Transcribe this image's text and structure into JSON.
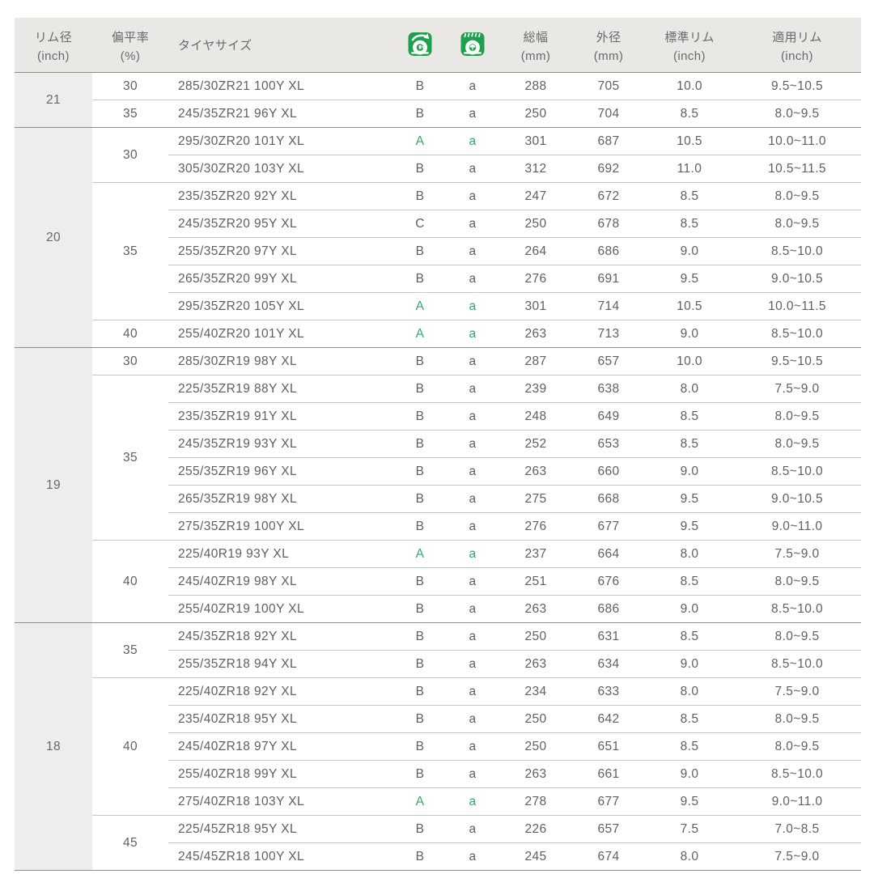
{
  "colors": {
    "icon_green": "#1ea050",
    "grade_green": "#39a566",
    "header_bg": "#eae8e5",
    "rim_column_bg": "#efedeb",
    "section_line": "#8f8d8a",
    "row_line": "#c8c6c3",
    "text": "#5f5f5f"
  },
  "table": {
    "columns": [
      {
        "key": "rim",
        "label": "リム径",
        "sub": "(inch)",
        "icon": null
      },
      {
        "key": "aspect",
        "label": "偏平率",
        "sub": "(%)",
        "icon": null
      },
      {
        "key": "size",
        "label": "タイヤサイズ",
        "sub": "",
        "icon": null
      },
      {
        "key": "fuel",
        "label": "",
        "sub": "",
        "icon": "fuel-efficiency-icon"
      },
      {
        "key": "wet",
        "label": "",
        "sub": "",
        "icon": "wet-grip-icon"
      },
      {
        "key": "width",
        "label": "総幅",
        "sub": "(mm)",
        "icon": null
      },
      {
        "key": "outer",
        "label": "外径",
        "sub": "(mm)",
        "icon": null
      },
      {
        "key": "std",
        "label": "標準リム",
        "sub": "(inch)",
        "icon": null
      },
      {
        "key": "range",
        "label": "適用リム",
        "sub": "(inch)",
        "icon": null
      }
    ],
    "sections": [
      {
        "rim": "21",
        "groups": [
          {
            "aspect": "30",
            "rows": [
              {
                "size": "285/30ZR21 100Y XL",
                "fuel": "B",
                "wet": "a",
                "width": "288",
                "outer": "705",
                "std": "10.0",
                "range": "9.5~10.5",
                "hl": false
              }
            ]
          },
          {
            "aspect": "35",
            "rows": [
              {
                "size": "245/35ZR21 96Y XL",
                "fuel": "B",
                "wet": "a",
                "width": "250",
                "outer": "704",
                "std": "8.5",
                "range": "8.0~9.5",
                "hl": false
              }
            ]
          }
        ]
      },
      {
        "rim": "20",
        "groups": [
          {
            "aspect": "30",
            "rows": [
              {
                "size": "295/30ZR20 101Y XL",
                "fuel": "A",
                "wet": "a",
                "width": "301",
                "outer": "687",
                "std": "10.5",
                "range": "10.0~11.0",
                "hl": true
              },
              {
                "size": "305/30ZR20 103Y XL",
                "fuel": "B",
                "wet": "a",
                "width": "312",
                "outer": "692",
                "std": "11.0",
                "range": "10.5~11.5",
                "hl": false
              }
            ]
          },
          {
            "aspect": "35",
            "rows": [
              {
                "size": "235/35ZR20 92Y XL",
                "fuel": "B",
                "wet": "a",
                "width": "247",
                "outer": "672",
                "std": "8.5",
                "range": "8.0~9.5",
                "hl": false
              },
              {
                "size": "245/35ZR20 95Y XL",
                "fuel": "C",
                "wet": "a",
                "width": "250",
                "outer": "678",
                "std": "8.5",
                "range": "8.0~9.5",
                "hl": false
              },
              {
                "size": "255/35ZR20 97Y XL",
                "fuel": "B",
                "wet": "a",
                "width": "264",
                "outer": "686",
                "std": "9.0",
                "range": "8.5~10.0",
                "hl": false
              },
              {
                "size": "265/35ZR20 99Y XL",
                "fuel": "B",
                "wet": "a",
                "width": "276",
                "outer": "691",
                "std": "9.5",
                "range": "9.0~10.5",
                "hl": false
              },
              {
                "size": "295/35ZR20 105Y XL",
                "fuel": "A",
                "wet": "a",
                "width": "301",
                "outer": "714",
                "std": "10.5",
                "range": "10.0~11.5",
                "hl": true
              }
            ]
          },
          {
            "aspect": "40",
            "rows": [
              {
                "size": "255/40ZR20 101Y XL",
                "fuel": "A",
                "wet": "a",
                "width": "263",
                "outer": "713",
                "std": "9.0",
                "range": "8.5~10.0",
                "hl": true
              }
            ]
          }
        ]
      },
      {
        "rim": "19",
        "groups": [
          {
            "aspect": "30",
            "rows": [
              {
                "size": "285/30ZR19 98Y XL",
                "fuel": "B",
                "wet": "a",
                "width": "287",
                "outer": "657",
                "std": "10.0",
                "range": "9.5~10.5",
                "hl": false
              }
            ]
          },
          {
            "aspect": "35",
            "rows": [
              {
                "size": "225/35ZR19 88Y XL",
                "fuel": "B",
                "wet": "a",
                "width": "239",
                "outer": "638",
                "std": "8.0",
                "range": "7.5~9.0",
                "hl": false
              },
              {
                "size": "235/35ZR19 91Y XL",
                "fuel": "B",
                "wet": "a",
                "width": "248",
                "outer": "649",
                "std": "8.5",
                "range": "8.0~9.5",
                "hl": false
              },
              {
                "size": "245/35ZR19 93Y XL",
                "fuel": "B",
                "wet": "a",
                "width": "252",
                "outer": "653",
                "std": "8.5",
                "range": "8.0~9.5",
                "hl": false
              },
              {
                "size": "255/35ZR19 96Y XL",
                "fuel": "B",
                "wet": "a",
                "width": "263",
                "outer": "660",
                "std": "9.0",
                "range": "8.5~10.0",
                "hl": false
              },
              {
                "size": "265/35ZR19 98Y XL",
                "fuel": "B",
                "wet": "a",
                "width": "275",
                "outer": "668",
                "std": "9.5",
                "range": "9.0~10.5",
                "hl": false
              },
              {
                "size": "275/35ZR19 100Y XL",
                "fuel": "B",
                "wet": "a",
                "width": "276",
                "outer": "677",
                "std": "9.5",
                "range": "9.0~11.0",
                "hl": false
              }
            ]
          },
          {
            "aspect": "40",
            "rows": [
              {
                "size": "225/40R19 93Y XL",
                "fuel": "A",
                "wet": "a",
                "width": "237",
                "outer": "664",
                "std": "8.0",
                "range": "7.5~9.0",
                "hl": true
              },
              {
                "size": "245/40ZR19 98Y XL",
                "fuel": "B",
                "wet": "a",
                "width": "251",
                "outer": "676",
                "std": "8.5",
                "range": "8.0~9.5",
                "hl": false
              },
              {
                "size": "255/40ZR19 100Y XL",
                "fuel": "B",
                "wet": "a",
                "width": "263",
                "outer": "686",
                "std": "9.0",
                "range": "8.5~10.0",
                "hl": false
              }
            ]
          }
        ]
      },
      {
        "rim": "18",
        "groups": [
          {
            "aspect": "35",
            "rows": [
              {
                "size": "245/35ZR18 92Y XL",
                "fuel": "B",
                "wet": "a",
                "width": "250",
                "outer": "631",
                "std": "8.5",
                "range": "8.0~9.5",
                "hl": false
              },
              {
                "size": "255/35ZR18 94Y XL",
                "fuel": "B",
                "wet": "a",
                "width": "263",
                "outer": "634",
                "std": "9.0",
                "range": "8.5~10.0",
                "hl": false
              }
            ]
          },
          {
            "aspect": "40",
            "rows": [
              {
                "size": "225/40ZR18 92Y XL",
                "fuel": "B",
                "wet": "a",
                "width": "234",
                "outer": "633",
                "std": "8.0",
                "range": "7.5~9.0",
                "hl": false
              },
              {
                "size": "235/40ZR18 95Y XL",
                "fuel": "B",
                "wet": "a",
                "width": "250",
                "outer": "642",
                "std": "8.5",
                "range": "8.0~9.5",
                "hl": false
              },
              {
                "size": "245/40ZR18 97Y XL",
                "fuel": "B",
                "wet": "a",
                "width": "250",
                "outer": "651",
                "std": "8.5",
                "range": "8.0~9.5",
                "hl": false
              },
              {
                "size": "255/40ZR18 99Y XL",
                "fuel": "B",
                "wet": "a",
                "width": "263",
                "outer": "661",
                "std": "9.0",
                "range": "8.5~10.0",
                "hl": false
              },
              {
                "size": "275/40ZR18 103Y XL",
                "fuel": "A",
                "wet": "a",
                "width": "278",
                "outer": "677",
                "std": "9.5",
                "range": "9.0~11.0",
                "hl": true
              }
            ]
          },
          {
            "aspect": "45",
            "rows": [
              {
                "size": "225/45ZR18 95Y XL",
                "fuel": "B",
                "wet": "a",
                "width": "226",
                "outer": "657",
                "std": "7.5",
                "range": "7.0~8.5",
                "hl": false
              },
              {
                "size": "245/45ZR18 100Y XL",
                "fuel": "B",
                "wet": "a",
                "width": "245",
                "outer": "674",
                "std": "8.0",
                "range": "7.5~9.0",
                "hl": false
              }
            ]
          }
        ]
      }
    ]
  }
}
